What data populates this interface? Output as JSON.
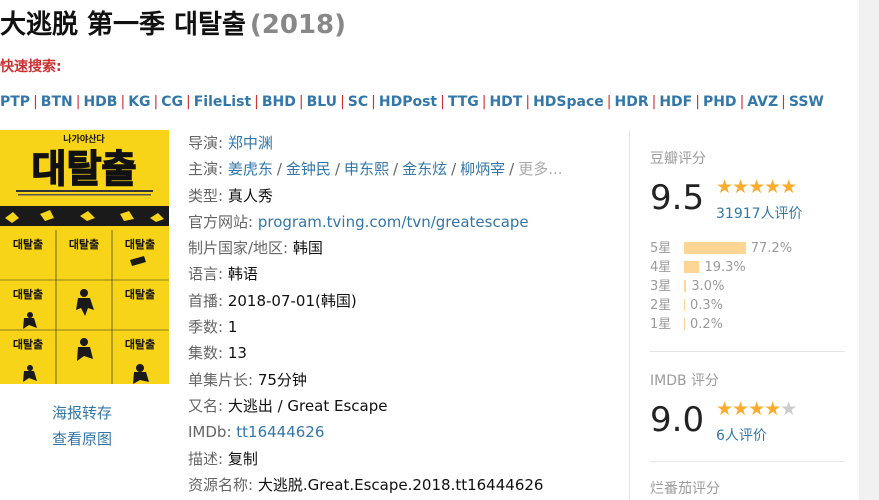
{
  "title": {
    "main": "大逃脱 第一季 대탈출",
    "year": "(2018)"
  },
  "quick_search": {
    "label": "快速搜索:",
    "sites": [
      "PTP",
      "BTN",
      "HDB",
      "KG",
      "CG",
      "FileList",
      "BHD",
      "BLU",
      "SC",
      "HDPost",
      "TTG",
      "HDT",
      "HDSpace",
      "HDR",
      "HDF",
      "PHD",
      "AVZ",
      "SSW"
    ]
  },
  "poster": {
    "top_text": "나가야산다",
    "logo_text": "대탈출",
    "tile_text": "대탈출",
    "actions": [
      "海报转存",
      "查看原图"
    ]
  },
  "info": {
    "director": {
      "label": "导演:",
      "value": "郑中渊"
    },
    "cast": {
      "label": "主演:",
      "values": [
        "姜虎东",
        "金钟民",
        "申东熙",
        "金东炫",
        "柳炳宰"
      ],
      "more": "更多..."
    },
    "genre": {
      "label": "类型:",
      "value": "真人秀"
    },
    "website": {
      "label": "官方网站:",
      "value": "program.tving.com/tvn/greatescape"
    },
    "country": {
      "label": "制片国家/地区:",
      "value": "韩国"
    },
    "language": {
      "label": "语言:",
      "value": "韩语"
    },
    "premiere": {
      "label": "首播:",
      "value": "2018-07-01(韩国)"
    },
    "seasons": {
      "label": "季数:",
      "value": "1"
    },
    "episodes": {
      "label": "集数:",
      "value": "13"
    },
    "runtime": {
      "label": "单集片长:",
      "value": "75分钟"
    },
    "aka": {
      "label": "又名:",
      "value": "大逃出 / Great Escape"
    },
    "imdb": {
      "label": "IMDb:",
      "value": "tt16444626"
    },
    "desc": {
      "label": "描述:",
      "value": "复制"
    },
    "resource": {
      "label": "资源名称:",
      "value": "大逃脱.Great.Escape.2018.tt16444626"
    }
  },
  "douban": {
    "head": "豆瓣评分",
    "score": "9.5",
    "stars": 5,
    "votes": "31917人评价",
    "distribution": [
      {
        "label": "5星",
        "pct": "77.2%",
        "value": 77.2
      },
      {
        "label": "4星",
        "pct": "19.3%",
        "value": 19.3
      },
      {
        "label": "3星",
        "pct": "3.0%",
        "value": 3.0
      },
      {
        "label": "2星",
        "pct": "0.3%",
        "value": 0.3
      },
      {
        "label": "1星",
        "pct": "0.2%",
        "value": 0.2
      }
    ]
  },
  "imdb_rating": {
    "head": "IMDB 评分",
    "score": "9.0",
    "stars": 4,
    "votes": "6人评价"
  },
  "rotten": {
    "head": "烂番茄评分"
  },
  "colors": {
    "link": "#3377aa",
    "star": "#ffac2d",
    "bar": "#ffd596",
    "poster": "#f7d417"
  }
}
